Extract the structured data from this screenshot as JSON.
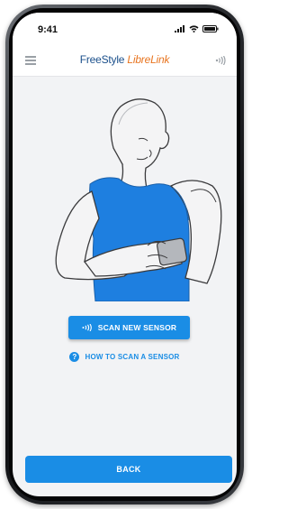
{
  "status_bar": {
    "time": "9:41"
  },
  "app_bar": {
    "brand_part1": "FreeStyle ",
    "brand_part2": "LibreLink"
  },
  "main": {
    "scan_button_label": "SCAN NEW SENSOR",
    "help_link_label": "HOW TO SCAN A SENSOR"
  },
  "footer": {
    "back_button_label": "BACK"
  },
  "icons": {
    "menu": "menu-icon",
    "sensor": "nfc-sensor-icon",
    "help": "question-circle-icon",
    "scan": "nfc-waves-icon"
  },
  "colors": {
    "accent": "#1a8de5",
    "brand_primary": "#1a4f8b",
    "brand_secondary": "#e8741f",
    "shirt_blue": "#1e7fe0",
    "background": "#f2f3f5"
  }
}
